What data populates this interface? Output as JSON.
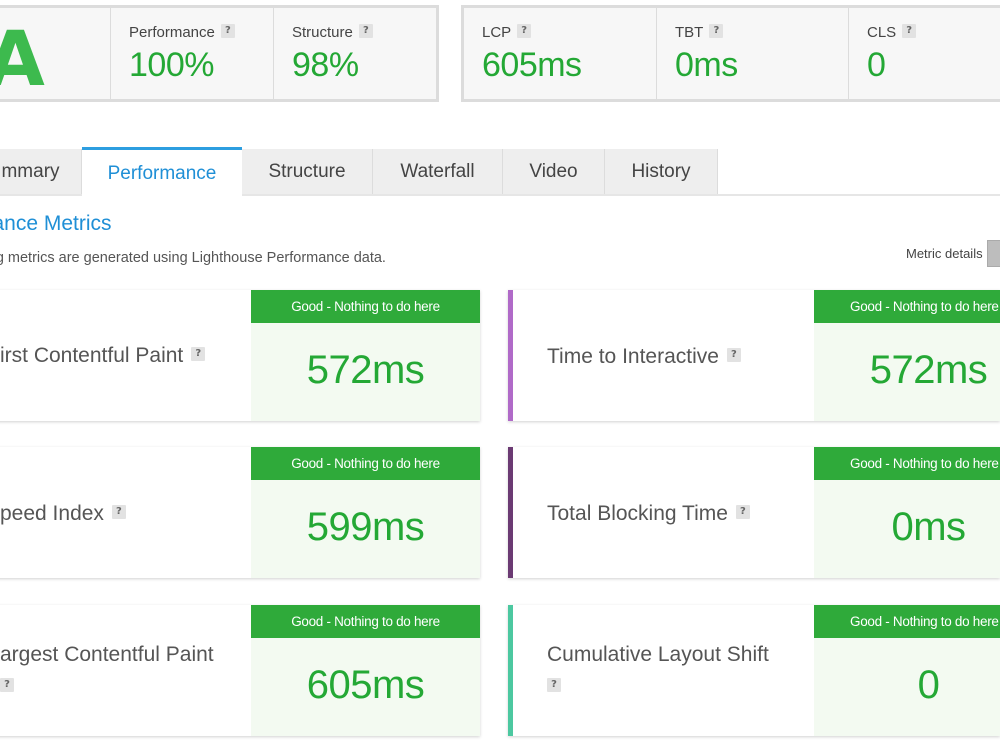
{
  "summary": {
    "grade": "A",
    "scores": [
      {
        "label": "Performance",
        "value": "100%"
      },
      {
        "label": "Structure",
        "value": "98%"
      }
    ],
    "vitals": [
      {
        "label": "LCP",
        "value": "605ms"
      },
      {
        "label": "TBT",
        "value": "0ms"
      },
      {
        "label": "CLS",
        "value": "0"
      }
    ],
    "help_glyph": "?"
  },
  "tabs": [
    "mmary",
    "Performance",
    "Structure",
    "Waterfall",
    "Video",
    "History"
  ],
  "section": {
    "title": "rmance Metrics",
    "description": "owing metrics are generated using Lighthouse Performance data.",
    "metric_details_label": "Metric details"
  },
  "metrics": [
    {
      "name": "irst Contentful Paint",
      "status": "Good - Nothing to do here",
      "value": "572ms",
      "accent": ""
    },
    {
      "name": "Time to Interactive",
      "status": "Good - Nothing to do here",
      "value": "572ms",
      "accent": "#b06ac8"
    },
    {
      "name": "peed Index",
      "status": "Good - Nothing to do here",
      "value": "599ms",
      "accent": ""
    },
    {
      "name": "Total Blocking Time",
      "status": "Good - Nothing to do here",
      "value": "0ms",
      "accent": "#6b3a73"
    },
    {
      "name": "argest Contentful Paint",
      "status": "Good - Nothing to do here",
      "value": "605ms",
      "accent": ""
    },
    {
      "name": "Cumulative Layout Shift",
      "status": "Good - Nothing to do here",
      "value": "0",
      "accent": "#4cc8a0"
    }
  ],
  "colors": {
    "good_green": "#2faa3a",
    "value_green": "#24a835",
    "link_blue": "#1f8fd6"
  }
}
